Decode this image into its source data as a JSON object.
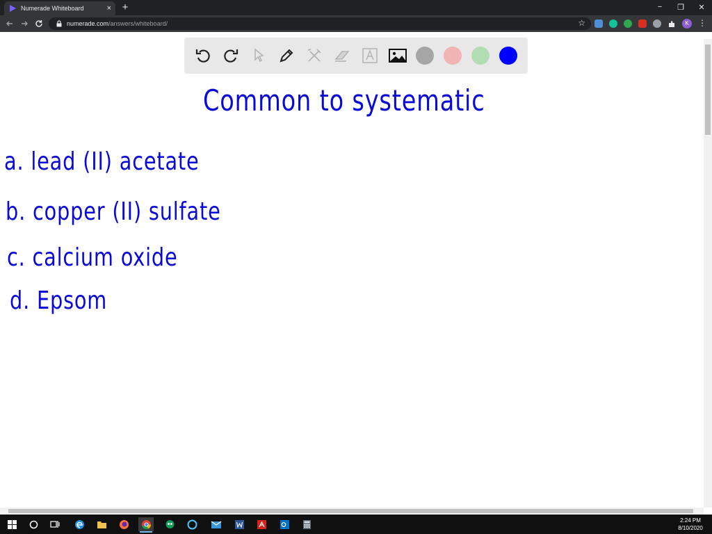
{
  "browser": {
    "tab_title": "Numerade Whiteboard",
    "tab_close": "×",
    "new_tab": "+",
    "url_host": "numerade.com",
    "url_path": "/answers/whiteboard/",
    "avatar_letter": "K",
    "window_minimize": "−",
    "window_restore": "❐",
    "window_close": "✕",
    "bookmark_star": "☆",
    "menu": "⋮"
  },
  "whiteboard": {
    "tools": [
      "undo-icon",
      "redo-icon",
      "select-pointer-icon",
      "pen-icon",
      "tools-icon",
      "eraser-icon",
      "text-icon",
      "image-icon"
    ],
    "colors": {
      "gray": "#a6a6a6",
      "pink": "#f0b4b4",
      "green": "#b4dcb4",
      "blue": "#0000ff"
    },
    "ink_color": "#0a0ad8",
    "handwriting": {
      "title": "Common to systematic",
      "items": [
        "a. lead (II) acetate",
        "b. copper (II) sulfate",
        "c. calcium oxide",
        "d. Epsom"
      ]
    }
  },
  "taskbar": {
    "icons": [
      "windows-start-icon",
      "search-circle-icon",
      "task-view-icon",
      "edge-icon",
      "file-explorer-icon",
      "firefox-icon",
      "chrome-icon",
      "hangouts-icon",
      "cortana-icon",
      "mail-icon",
      "word-icon",
      "acrobat-icon",
      "outlook-icon",
      "calculator-icon"
    ],
    "time": "2:24 PM",
    "date": "8/10/2020"
  }
}
